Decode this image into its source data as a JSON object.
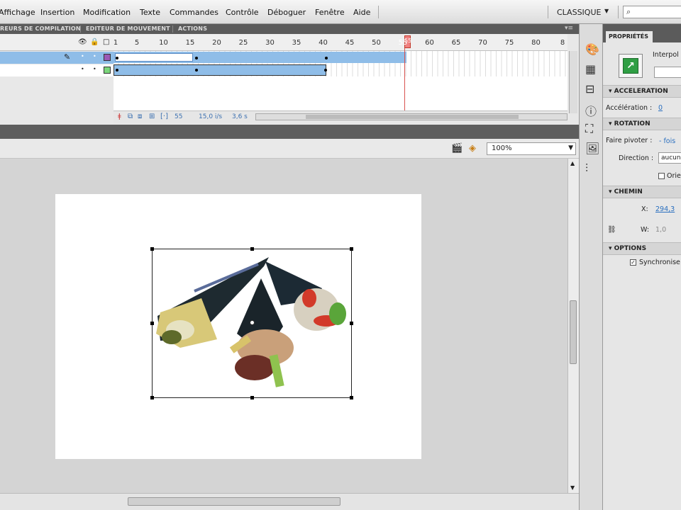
{
  "menu": {
    "items": [
      "Affichage",
      "Insertion",
      "Modification",
      "Texte",
      "Commandes",
      "Contrôle",
      "Déboguer",
      "Fenêtre",
      "Aide"
    ],
    "workspace": "CLASSIQUE",
    "workspace_arrow": "▼",
    "search_icon": "⌕"
  },
  "panel_tabs": [
    "ERREURS DE COMPILATION",
    "EDITEUR DE MOUVEMENT",
    "ACTIONS"
  ],
  "timeline": {
    "frame_numbers": [
      "1",
      "5",
      "10",
      "15",
      "20",
      "25",
      "30",
      "35",
      "40",
      "45",
      "50",
      "55",
      "60",
      "65",
      "70",
      "75",
      "80",
      "8"
    ],
    "current_frame": "55",
    "status": {
      "frame": "55",
      "fps": "15,0 i/s",
      "time": "3,6 s"
    },
    "layers": [
      {
        "color": "#9b59b6",
        "selected": true
      },
      {
        "color": "#7bd67b",
        "selected": false
      }
    ],
    "tween_color": "#8fbde8",
    "header_icons": {
      "eye": "👁",
      "lock": "🔒",
      "outline": "□"
    }
  },
  "editbar": {
    "zoom": "100%"
  },
  "properties": {
    "tab": "PROPRIÉTÉS",
    "interp_label": "Interpol",
    "sections": {
      "acceleration": {
        "header": "ACCELERATION",
        "label": "Accélération :",
        "value": "0"
      },
      "rotation": {
        "header": "ROTATION",
        "rotate_label": "Faire pivoter :",
        "rotate_value": "- fois",
        "direction_label": "Direction :",
        "direction_value": "aucun",
        "orient_label": "Orie"
      },
      "path": {
        "header": "CHEMIN",
        "x_label": "X:",
        "x_value": "294,3",
        "w_label": "W:",
        "w_value": "1,0"
      },
      "options": {
        "header": "OPTIONS",
        "sync_label": "Synchronise",
        "sync_checked": true
      }
    }
  }
}
